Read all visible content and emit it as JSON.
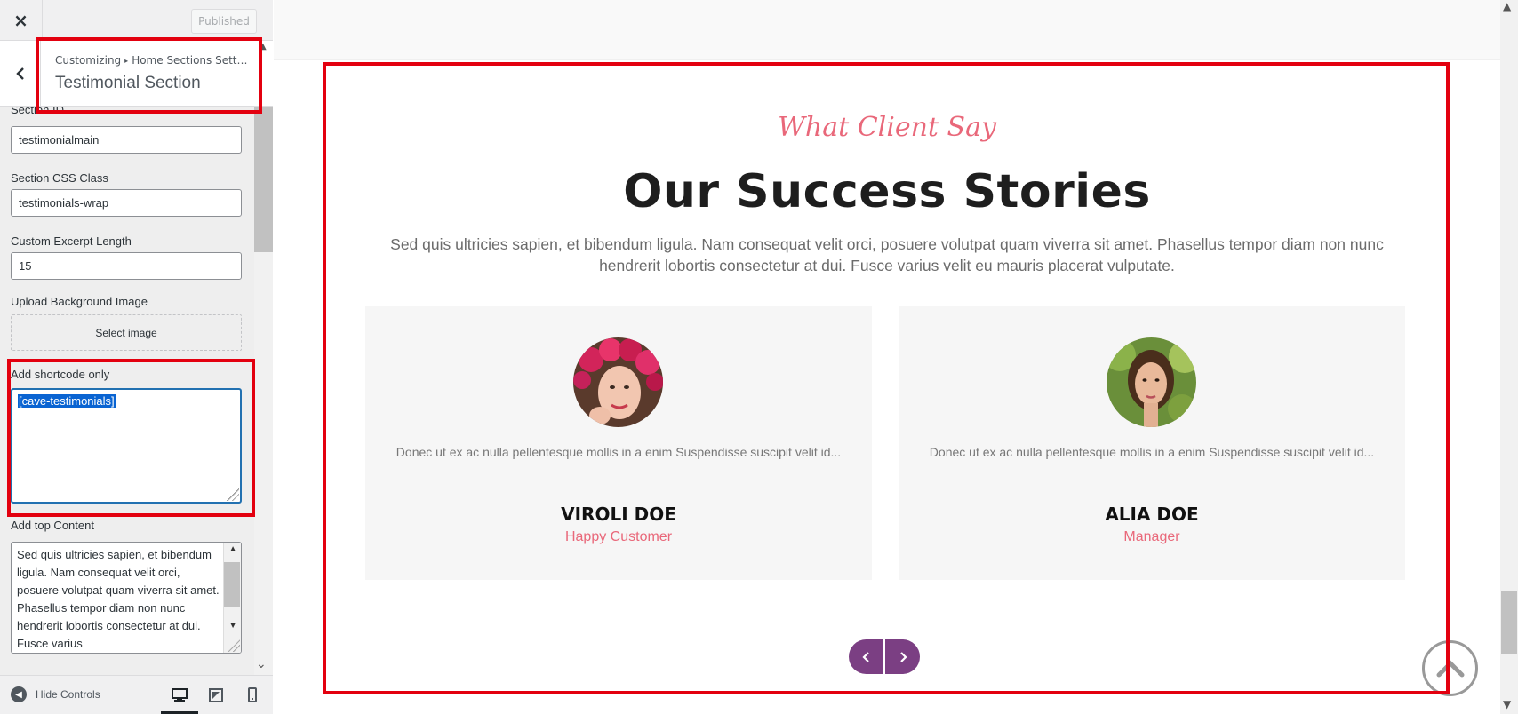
{
  "customizer": {
    "close_label": "×",
    "publish_label": "Published",
    "breadcrumb": {
      "root": "Customizing",
      "parent": "Home Sections Settin..."
    },
    "section_title": "Testimonial Section",
    "fields": {
      "section_id": {
        "label": "Section ID",
        "value": "testimonialmain"
      },
      "section_css_class": {
        "label": "Section CSS Class",
        "value": "testimonials-wrap"
      },
      "excerpt_length": {
        "label": "Custom Excerpt Length",
        "value": "15"
      },
      "bg_image": {
        "label": "Upload Background Image",
        "button": "Select image"
      },
      "shortcode": {
        "label": "Add shortcode only",
        "value": "[cave-testimonials]"
      },
      "top_content": {
        "label": "Add top Content",
        "value": "Sed quis ultricies sapien, et bibendum ligula. Nam consequat velit orci, posuere volutpat quam viverra sit amet. Phasellus tempor diam non nunc hendrerit lobortis consectetur at dui. Fusce varius"
      }
    },
    "footer": {
      "hide_controls_label": "Hide Controls"
    }
  },
  "preview": {
    "script_title": "What Client Say",
    "main_title": "Our Success Stories",
    "intro": "Sed quis ultricies sapien, et bibendum ligula. Nam consequat velit orci, posuere volutpat quam viverra sit amet. Phasellus tempor diam non nunc hendrerit lobortis consectetur at dui. Fusce varius velit eu mauris placerat vulputate.",
    "testimonials": [
      {
        "quote": "Donec ut ex ac nulla pellentesque mollis in a enim Suspendisse suscipit velit id...",
        "name": "VIROLI DOE",
        "role": "Happy Customer"
      },
      {
        "quote": "Donec ut ex ac nulla pellentesque mollis in a enim Suspendisse suscipit velit id...",
        "name": "ALIA DOE",
        "role": "Manager"
      }
    ]
  },
  "colors": {
    "accent_pink": "#e9687a",
    "nav_purple": "#7b3f83",
    "highlight_red": "#e3000f",
    "focus_blue": "#2271b1"
  },
  "icons": [
    "close-icon",
    "chevron-left-icon",
    "desktop-icon",
    "tablet-icon",
    "mobile-icon",
    "hide-controls-icon",
    "arrow-up-circle-icon"
  ]
}
